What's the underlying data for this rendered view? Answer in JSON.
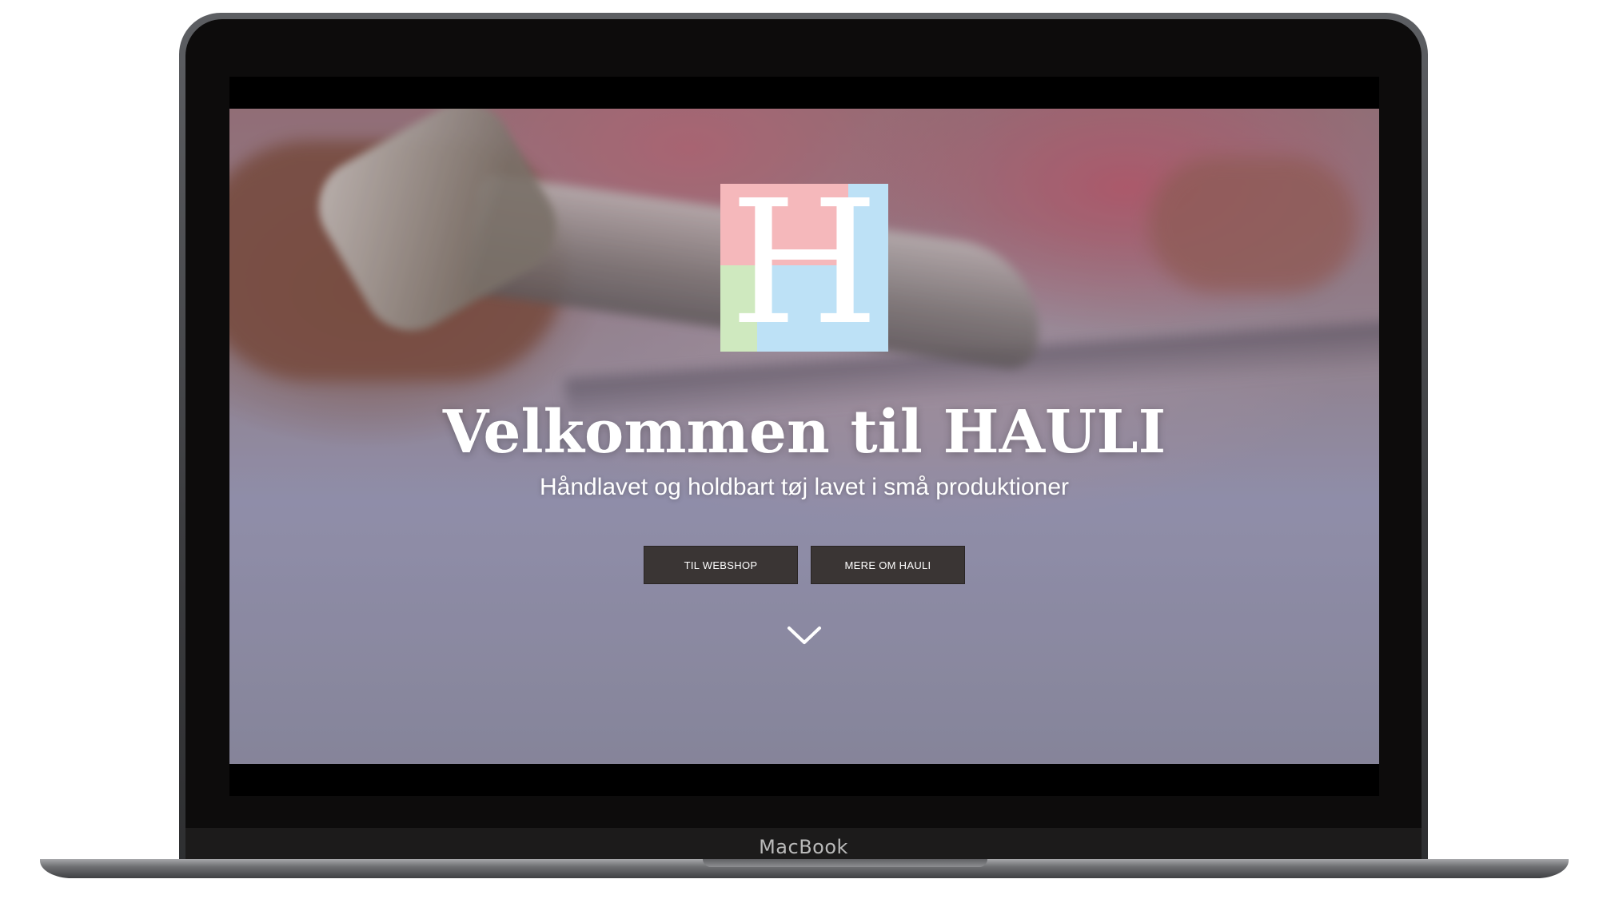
{
  "device": {
    "label": "MacBook"
  },
  "hero": {
    "logo_letter": "H",
    "title": "Velkommen til HAULI",
    "subtitle": "Håndlavet og holdbart tøj lavet i små produktioner",
    "buttons": {
      "webshop": "TIL WEBSHOP",
      "about": "MERE OM HAULI"
    },
    "scroll_icon": "chevron-down-icon"
  },
  "colors": {
    "logo_pink": "#f5b8bb",
    "logo_blue": "#bde1f6",
    "logo_green": "#cfe9bf",
    "button_bg": "#3a3534",
    "text": "#ffffff"
  }
}
